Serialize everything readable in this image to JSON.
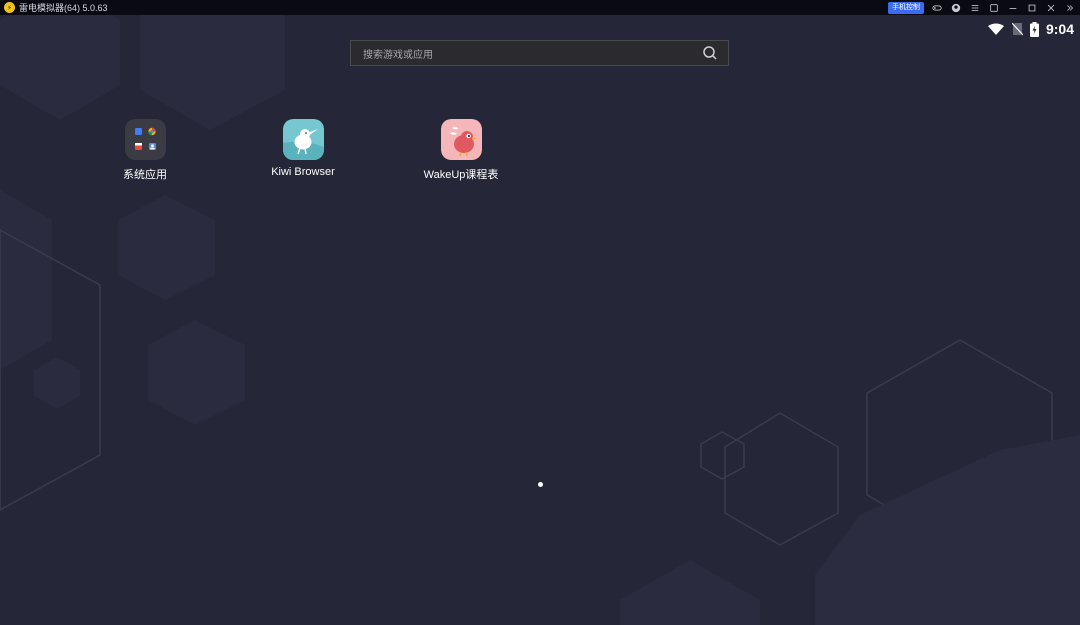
{
  "titlebar": {
    "title": "雷电模拟器(64) 5.0.63",
    "mobile_control_label": "手机控制",
    "icons": [
      "gamepad-icon",
      "account-icon",
      "menu-icon",
      "popout-icon",
      "minimize-icon",
      "maximize-icon",
      "close-icon",
      "expand-sidebar-icon"
    ]
  },
  "status": {
    "time": "9:04",
    "icons": [
      "wifi-icon",
      "no-sim-icon",
      "battery-charging-icon"
    ]
  },
  "search": {
    "placeholder": "搜索游戏或应用"
  },
  "apps": [
    {
      "label": "系统应用",
      "icon": "system-apps-folder-icon"
    },
    {
      "label": "Kiwi Browser",
      "icon": "kiwi-browser-icon"
    },
    {
      "label": "WakeUp课程表",
      "icon": "wakeup-schedule-icon"
    }
  ],
  "pager": {
    "pages": 1,
    "current": 1
  },
  "colors": {
    "background": "#252638",
    "titlebar": "#0a0a12",
    "mobile_control": "#3a6cf0",
    "search_bg": "#2b2b2e",
    "kiwi_icon": "#76c7cf",
    "wakeup_icon": "#f4b6b8"
  }
}
